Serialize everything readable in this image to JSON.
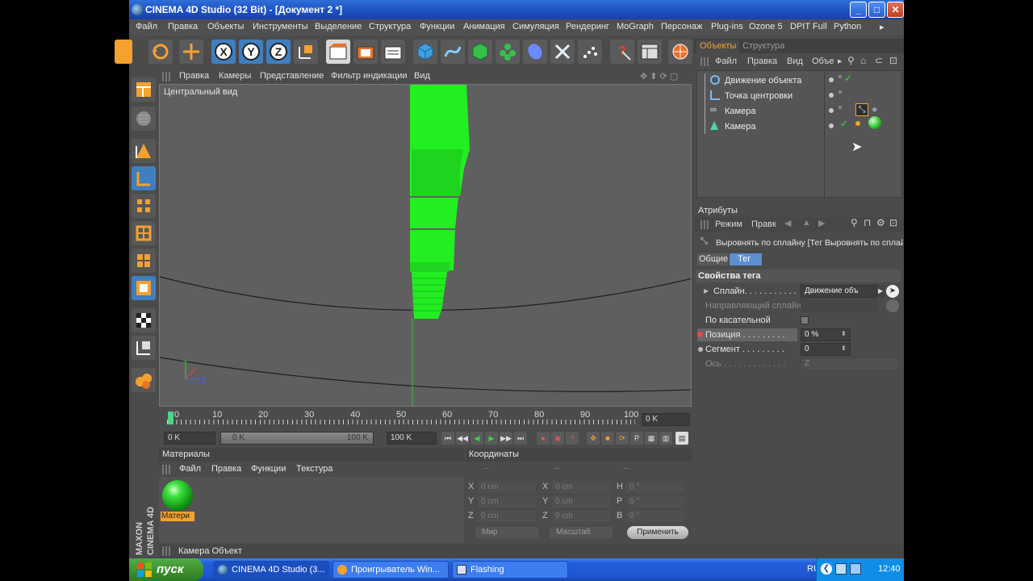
{
  "window": {
    "title": "CINEMA 4D Studio (32 Bit) - [Документ 2 *]",
    "min": "_",
    "max": "□",
    "close": "✕"
  },
  "menubar": [
    "Файл",
    "Правка",
    "Объекты",
    "Инструменты",
    "Выделение",
    "Структура",
    "Функции",
    "Анимация",
    "Симуляция",
    "Рендеринг",
    "MoGraph",
    "Персонаж",
    "Plug-ins",
    "Ozone 5",
    "DPIT Full",
    "Python",
    "▸"
  ],
  "toolbar": {
    "axis_x": "X",
    "axis_y": "Y",
    "axis_z": "Z"
  },
  "viewport": {
    "menu": [
      "Правка",
      "Камеры",
      "Представление",
      "Фильтр индикации",
      "Вид"
    ],
    "label": "Центральный вид",
    "accent": "#22ee22"
  },
  "timeline": {
    "ticks": [
      "0",
      "10",
      "20",
      "30",
      "40",
      "50",
      "60",
      "70",
      "80",
      "90",
      "100"
    ],
    "end_field": "0 K"
  },
  "controls": {
    "start_field": "0 K",
    "range_start": "0 K",
    "range_end": "100 K",
    "end_field": "100 K"
  },
  "materials": {
    "title": "Материалы",
    "menu": [
      "Файл",
      "Правка",
      "Функции",
      "Текстура"
    ],
    "item_label": "Матери"
  },
  "coords": {
    "title": "Координаты",
    "col_headers": [
      "--",
      "--",
      "--"
    ],
    "rows": [
      {
        "a": "X",
        "av": "0 cm",
        "b": "X",
        "bv": "0 cm",
        "c": "H",
        "cv": "0 °"
      },
      {
        "a": "Y",
        "av": "0 cm",
        "b": "Y",
        "bv": "0 cm",
        "c": "P",
        "cv": "0 °"
      },
      {
        "a": "Z",
        "av": "0 cm",
        "b": "Z",
        "bv": "0 cm",
        "c": "B",
        "cv": "0 °"
      }
    ],
    "world": "Мир",
    "scale": "Масштаб",
    "apply": "Применить"
  },
  "status": {
    "text": "Камера Объект"
  },
  "objects": {
    "tab_objects": "Объекты",
    "tab_structure": "Структура",
    "menu": [
      "Файл",
      "Правка",
      "Вид",
      "Объе"
    ],
    "items": [
      {
        "name": "Движение объекта"
      },
      {
        "name": "Точка центровки"
      },
      {
        "name": "Камера"
      },
      {
        "name": "Камера"
      }
    ]
  },
  "attributes": {
    "title": "Атрибуты",
    "menu": [
      "Режим",
      "Правк"
    ],
    "tag_title": "Выровнять по сплайну [Тег Выровнять по сплай",
    "tabs": [
      "Общие",
      "Тег"
    ],
    "section": "Свойства тега",
    "props": [
      {
        "label": "Сплайн. . . . . . . . . . .",
        "value": "Движение объ"
      },
      {
        "label": "Направляющий сплайн",
        "value": ""
      },
      {
        "label": "По касательной",
        "value": ""
      },
      {
        "label": "Позиция  . . . . . . . . .",
        "value": "0 %"
      },
      {
        "label": "Сегмент  . . . . . . . . .",
        "value": "0"
      },
      {
        "label": "Ось . . . . . . . . . . . . .",
        "value": "Z"
      }
    ]
  },
  "taskbar": {
    "start": "пуск",
    "items": [
      "CINEMA 4D Studio (3...",
      "Проигрыватель Win...",
      "Flashing"
    ],
    "lang": "RU",
    "clock": "12:40"
  }
}
